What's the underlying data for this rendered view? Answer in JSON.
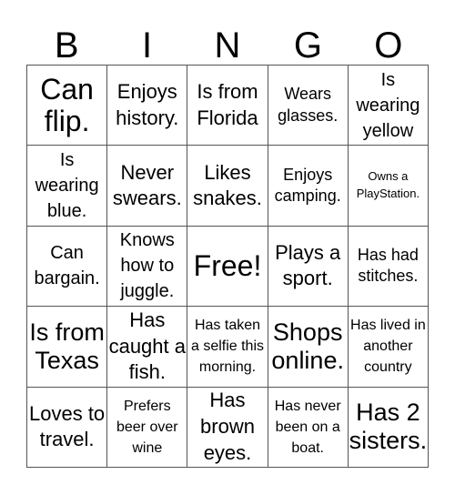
{
  "header": {
    "letters": [
      "B",
      "I",
      "N",
      "G",
      "O"
    ]
  },
  "grid": {
    "cells": [
      "Can flip.",
      "Enjoys history.",
      "Is from Florida",
      "Wears glasses.",
      "Is wearing yellow",
      "Is wearing blue.",
      "Never swears.",
      "Likes snakes.",
      "Enjoys camping.",
      "Owns a PlayStation.",
      "Can bargain.",
      "Knows how to juggle.",
      "Free!",
      "Plays a sport.",
      "Has had stitches.",
      "Is from Texas",
      "Has caught a fish.",
      "Has taken a selfie this morning.",
      "Shops online.",
      "Has lived in another country",
      "Loves to travel.",
      "Prefers beer over wine",
      "Has brown eyes.",
      "Has never been on a boat.",
      "Has 2 sisters."
    ]
  }
}
